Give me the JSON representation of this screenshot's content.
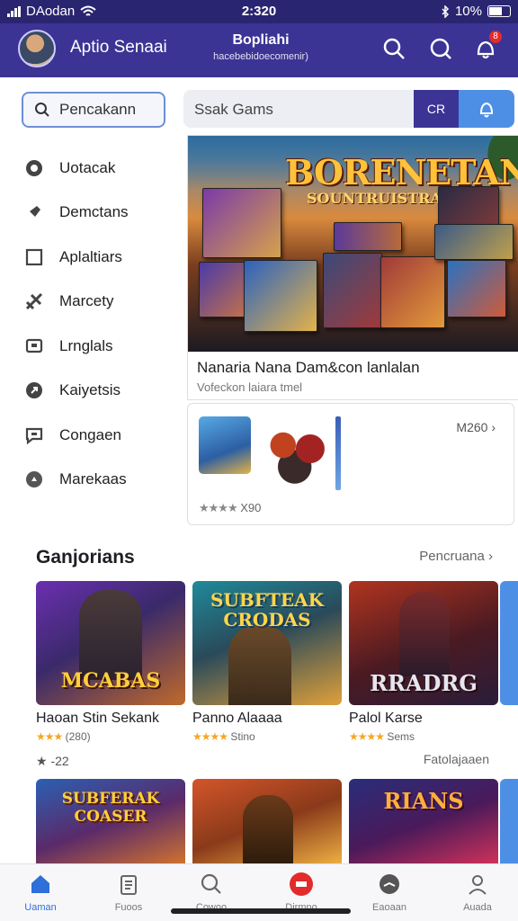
{
  "status_bar": {
    "carrier": "DAodan",
    "time": "2:320",
    "battery": "10%"
  },
  "app_bar": {
    "title": "Aptio Senaai",
    "center_title": "Bopliahi",
    "center_subtitle": "hacebebidoecomenir)",
    "notification_badge": "8"
  },
  "sidebar": {
    "search_label": "Pencakann",
    "items": [
      {
        "label": "Uotacak",
        "icon": "compass-icon"
      },
      {
        "label": "Demctans",
        "icon": "pin-icon"
      },
      {
        "label": "Aplaltiars",
        "icon": "square-icon"
      },
      {
        "label": "Marcety",
        "icon": "tag-icon"
      },
      {
        "label": "Lrnglals",
        "icon": "tv-icon"
      },
      {
        "label": "Kaiyetsis",
        "icon": "refresh-icon"
      },
      {
        "label": "Congaen",
        "icon": "chat-icon"
      },
      {
        "label": "Marekaas",
        "icon": "play-circle-icon"
      }
    ]
  },
  "search": {
    "placeholder": "Ssak Gams",
    "button_label": "CR"
  },
  "featured": {
    "hero_title": "BORENETAN",
    "hero_subtitle": "SOUNTRUISTRAN",
    "caption": "Nanaria Nana Dam&con lanlalan",
    "subcaption": "Vofeckon laiara tmel"
  },
  "promo_card": {
    "price": "M260",
    "rating_value": "X90",
    "stars": "★★★★"
  },
  "section": {
    "title": "Ganjorians",
    "link": "Pencruana",
    "games": [
      {
        "title": "Haoan Stin Sekank",
        "subtitle": "(280)",
        "stars": "★★★",
        "art_text": "MCABAS",
        "colors": [
          "#6b2fb0",
          "#c06a2a"
        ]
      },
      {
        "title": "Panno Alaaaa",
        "subtitle": "Stino",
        "stars": "★★★★",
        "art_text": "SUBFTEAK CRODAS",
        "colors": [
          "#1f8a9a",
          "#e0a03a"
        ]
      },
      {
        "title": "Palol Karse",
        "subtitle": "Sems",
        "stars": "★★★★",
        "art_text": "RRADRG",
        "colors": [
          "#b0341f",
          "#2a1d3a"
        ]
      }
    ],
    "row2_left": "-22",
    "row2_right": "Fatolajaaen",
    "games_row2": [
      {
        "art_text": "SUBFERAK COASER",
        "colors": [
          "#2b60b3",
          "#d8772b"
        ]
      },
      {
        "art_text": "",
        "colors": [
          "#d4552a",
          "#f5b845"
        ]
      },
      {
        "art_text": "RIANS",
        "colors": [
          "#2a2d7a",
          "#d9335a"
        ]
      }
    ]
  },
  "bottom_nav": [
    {
      "label": "Uaman",
      "icon": "home-icon",
      "active": true
    },
    {
      "label": "Fuoos",
      "icon": "clipboard-icon",
      "active": false
    },
    {
      "label": "Cowoo",
      "icon": "search-icon",
      "active": false
    },
    {
      "label": "Dirmno",
      "icon": "record-icon",
      "active": false
    },
    {
      "label": "Eaoaan",
      "icon": "gauge-icon",
      "active": false
    },
    {
      "label": "Auada",
      "icon": "profile-icon",
      "active": false
    }
  ],
  "colors": {
    "brand": "#3b3495",
    "accent": "#4e8fe6",
    "star": "#f5a623"
  }
}
